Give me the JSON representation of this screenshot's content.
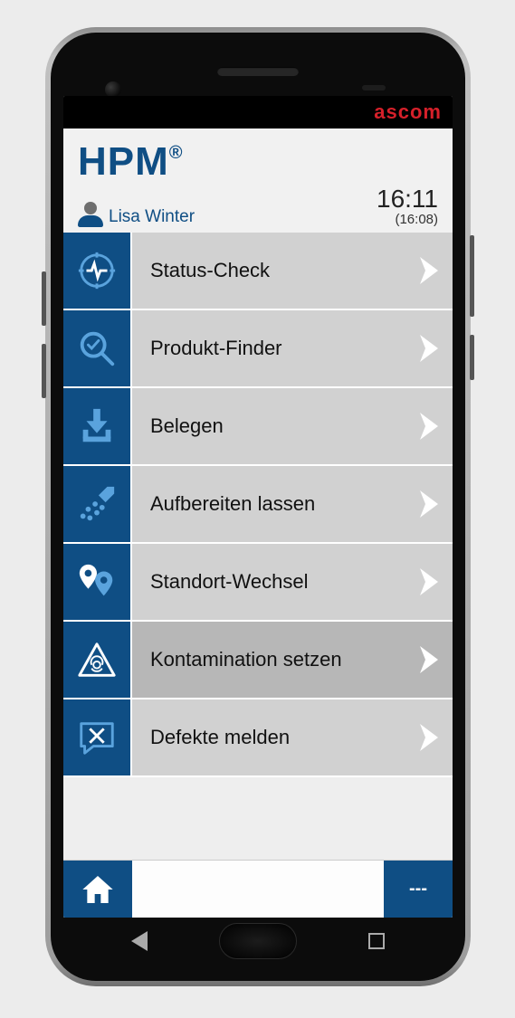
{
  "device": {
    "brand": "ascom"
  },
  "app": {
    "title": "HPM",
    "registered_mark": "®"
  },
  "user": {
    "name": "Lisa Winter"
  },
  "clock": {
    "current": "16:11",
    "sub": "(16:08)"
  },
  "menu": [
    {
      "icon": "pulse-target-icon",
      "label": "Status-Check",
      "highlight": false
    },
    {
      "icon": "magnifier-check-icon",
      "label": "Produkt-Finder",
      "highlight": false
    },
    {
      "icon": "download-tray-icon",
      "label": "Belegen",
      "highlight": false
    },
    {
      "icon": "spray-icon",
      "label": "Aufbereiten lassen",
      "highlight": false
    },
    {
      "icon": "location-swap-icon",
      "label": "Standort-Wechsel",
      "highlight": false
    },
    {
      "icon": "biohazard-icon",
      "label": "Kontamination setzen",
      "highlight": true
    },
    {
      "icon": "tools-chat-icon",
      "label": "Defekte melden",
      "highlight": false
    }
  ],
  "footer": {
    "home": "home",
    "more": "---"
  }
}
